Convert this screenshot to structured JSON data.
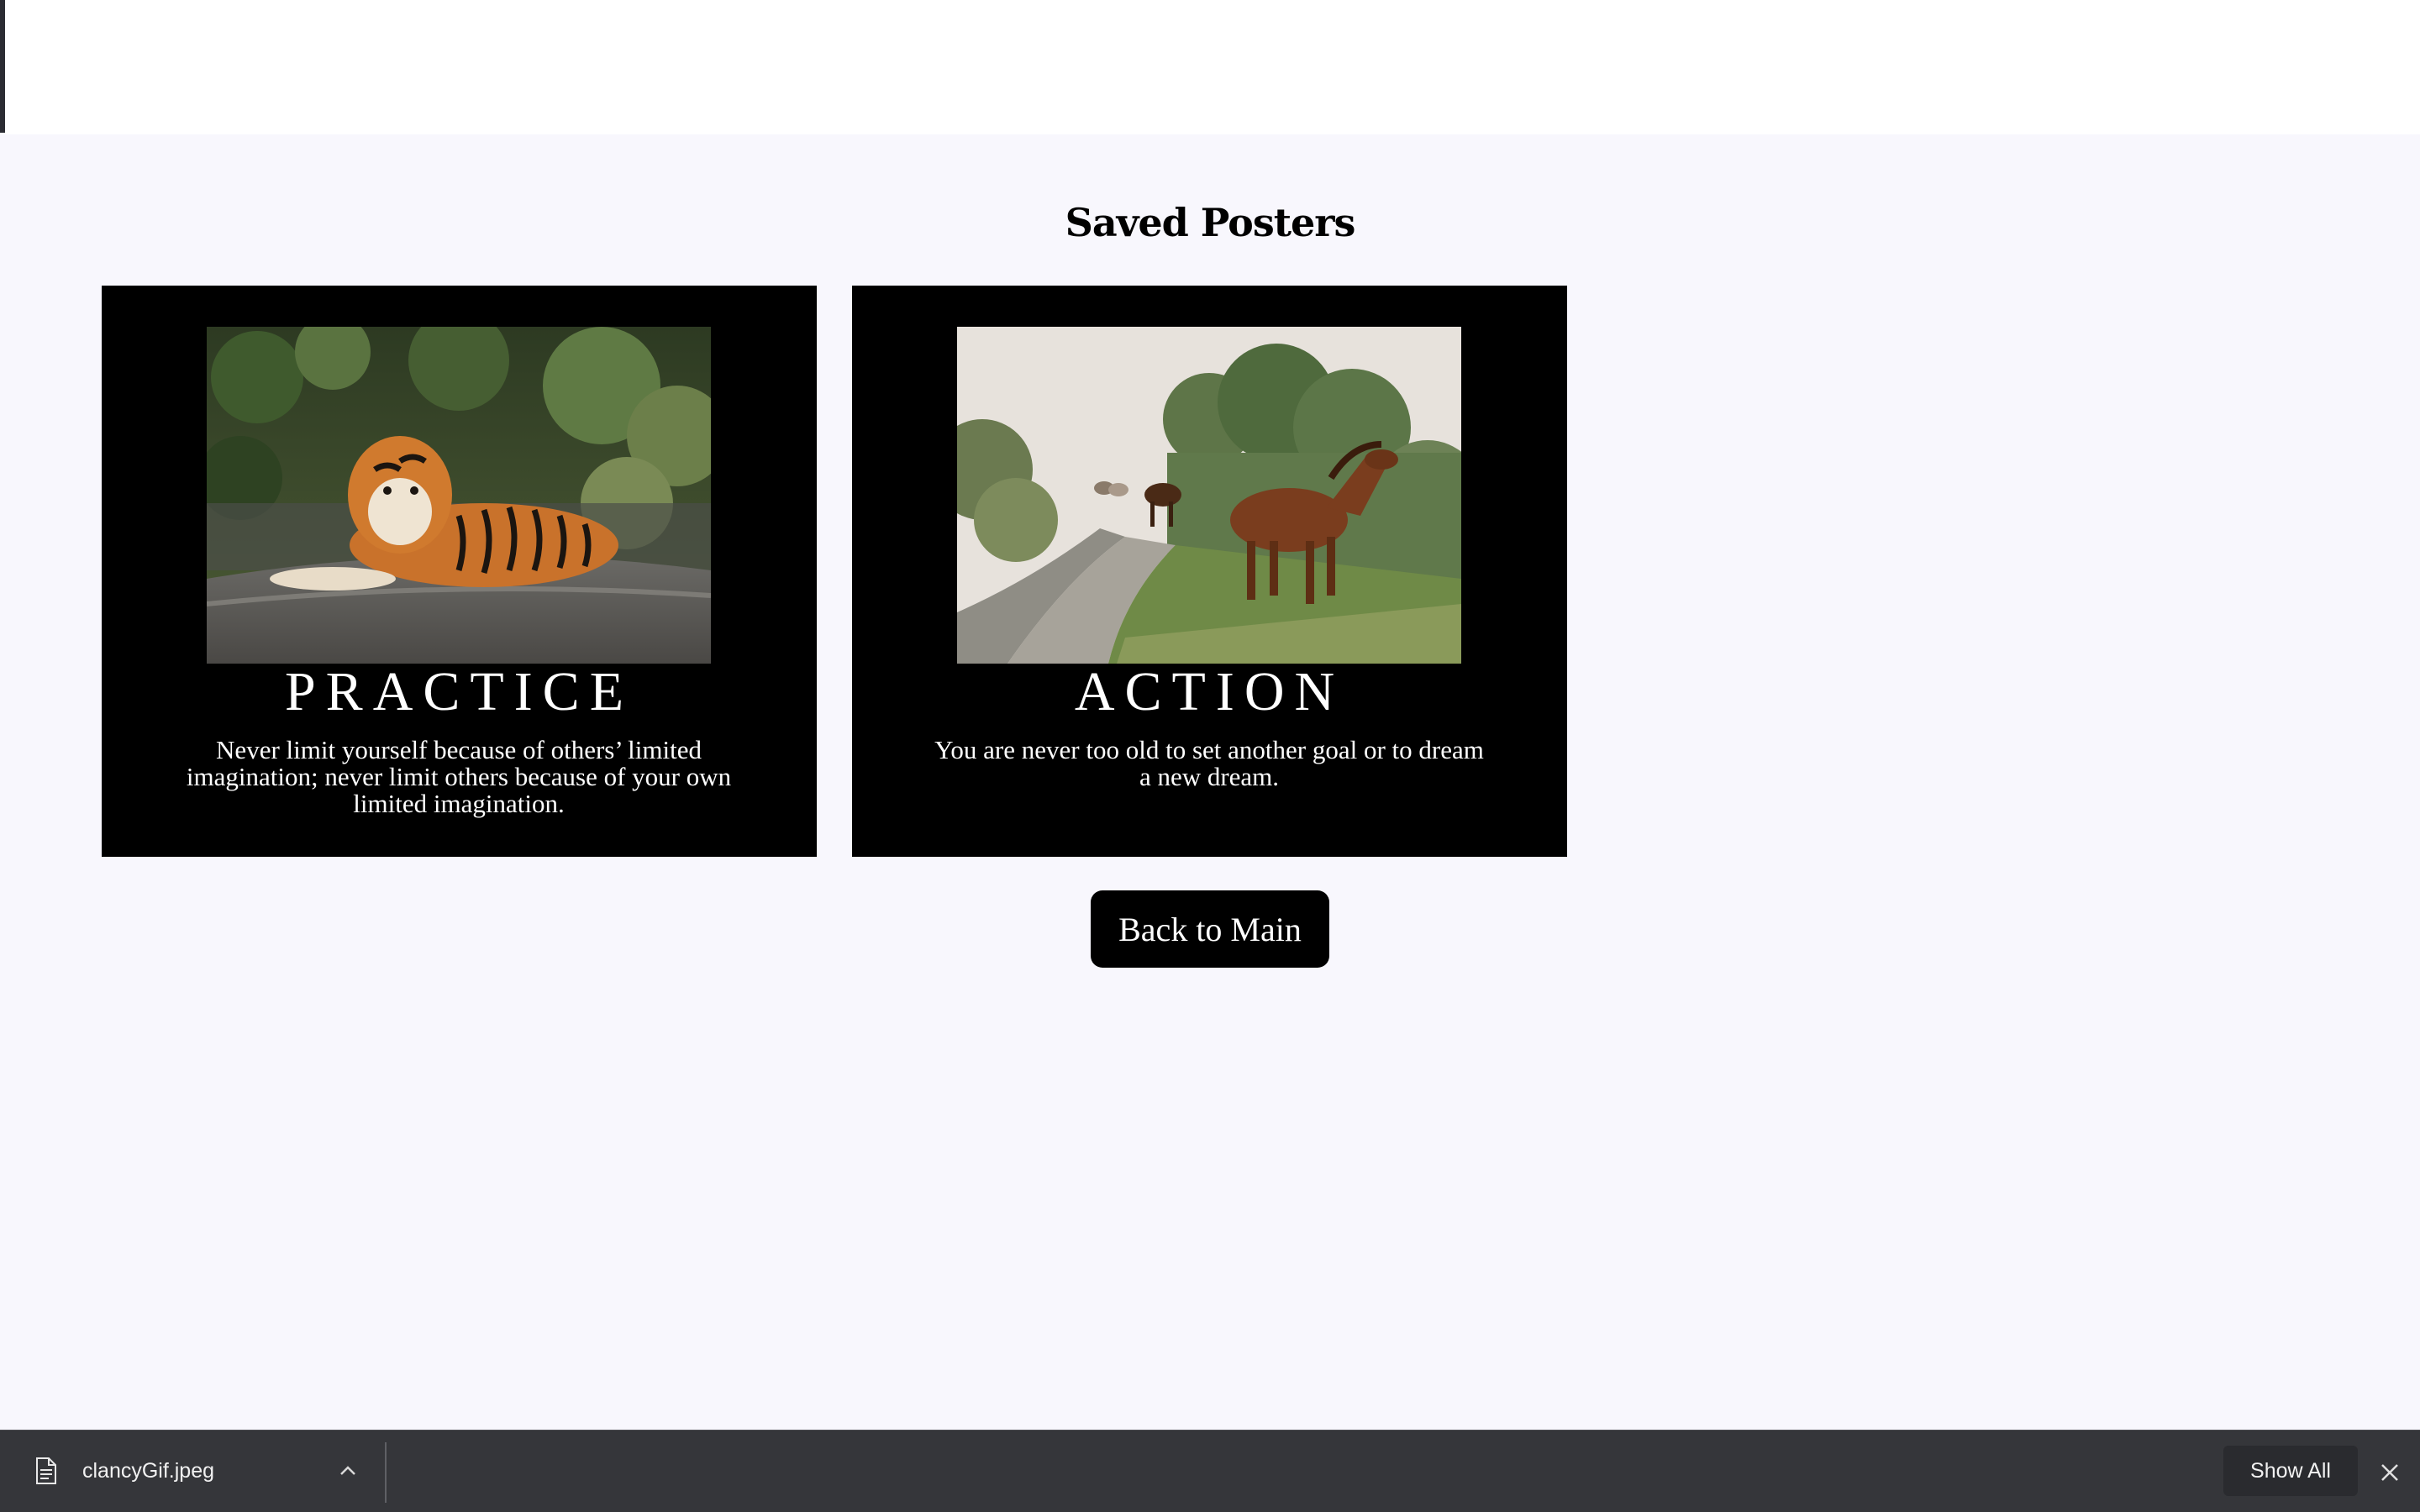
{
  "page": {
    "title": "Saved Posters"
  },
  "posters": [
    {
      "word": "PRACTICE",
      "quote": "Never limit yourself because of others’ limited imagination; never limit others because of your own limited imagination.",
      "image": "tiger-photo"
    },
    {
      "word": "ACTION",
      "quote": "You are never too old to set another goal or to dream a new dream.",
      "image": "horses-photo"
    }
  ],
  "buttons": {
    "back_label": "Back to Main"
  },
  "download_bar": {
    "file_name": "clancyGif.jpeg",
    "file_icon": "document-icon",
    "show_all_label": "Show All",
    "close_icon": "close-icon"
  },
  "colors": {
    "background": "#f8f7fd",
    "poster_bg": "#000000",
    "download_bar_bg": "#35363a"
  }
}
